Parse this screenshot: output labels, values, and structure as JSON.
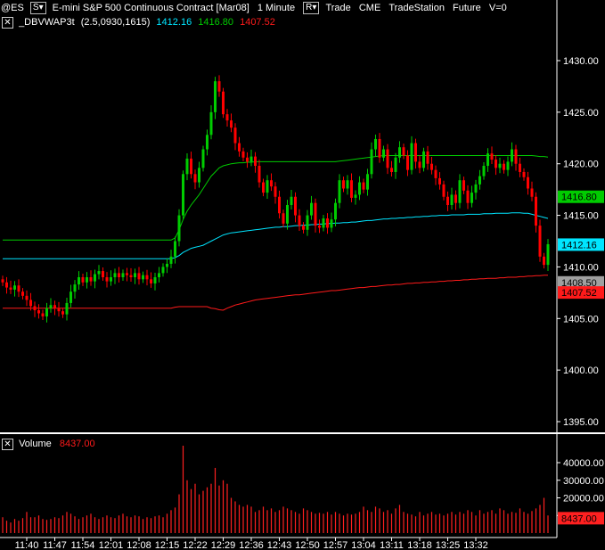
{
  "header": {
    "symbol": "@ES",
    "symbol_button": "S▾",
    "description": "E-mini S&P 500 Continuous Contract [Mar08]",
    "interval": "1 Minute",
    "range_button": "R▾",
    "mode": "Trade",
    "exchange": "CME",
    "source": "TradeStation",
    "category": "Future",
    "volume_flag": "V=0"
  },
  "indicator": {
    "close_icon": "close-x-icon",
    "name": "_DBVWAP3t",
    "params": "(2.5,0930,1615)",
    "value_cyan": "1412.16",
    "value_green": "1416.80",
    "value_red": "1407.52"
  },
  "volume_panel": {
    "close_icon": "close-x-icon",
    "title": "Volume",
    "value": "8437.00"
  },
  "colors": {
    "up": "#00cc00",
    "down": "#ff0000",
    "vwap": "#00e5ff",
    "upper_band": "#00cc00",
    "lower_band": "#ff1a1a",
    "volume": "#ff2020",
    "axis_text": "#ffffff",
    "separator": "#ffffff"
  },
  "chart_data": [
    {
      "type": "candlestick",
      "ylim": [
        1393.5,
        1432
      ],
      "price_ticks": [
        1430.0,
        1425.0,
        1420.0,
        1415.0,
        1410.0,
        1405.0,
        1400.0,
        1395.0
      ],
      "price_tick_labels": [
        "1430.00",
        "1425.00",
        "1420.00",
        "1415.00",
        "1410.00",
        "1405.00",
        "1400.00",
        "1395.00"
      ],
      "time_labels": [
        "11:40",
        "11:47",
        "11:54",
        "12:01",
        "12:08",
        "12:15",
        "12:22",
        "12:29",
        "12:36",
        "12:43",
        "12:50",
        "12:57",
        "13:04",
        "13:11",
        "13:18",
        "13:25",
        "13:32"
      ],
      "bar_minutes_start": "11:34",
      "close": [
        1408.5,
        1408.0,
        1407.8,
        1408.2,
        1407.6,
        1407.2,
        1406.8,
        1406.2,
        1405.8,
        1405.5,
        1405.2,
        1406.0,
        1406.3,
        1406.0,
        1405.7,
        1405.4,
        1406.5,
        1407.6,
        1408.3,
        1409.0,
        1408.5,
        1409.0,
        1408.6,
        1409.3,
        1409.6,
        1409.0,
        1408.6,
        1409.0,
        1409.4,
        1409.0,
        1409.4,
        1409.2,
        1409.0,
        1409.4,
        1408.8,
        1409.2,
        1408.8,
        1408.4,
        1409.0,
        1409.4,
        1410.0,
        1410.3,
        1411.0,
        1412.5,
        1415.0,
        1419.0,
        1420.5,
        1419.0,
        1418.2,
        1419.6,
        1421.4,
        1422.8,
        1425.0,
        1428.0,
        1427.0,
        1424.8,
        1424.2,
        1423.5,
        1422.0,
        1421.2,
        1420.6,
        1420.2,
        1420.7,
        1419.8,
        1418.2,
        1417.2,
        1418.4,
        1417.8,
        1416.8,
        1415.2,
        1414.2,
        1416.0,
        1416.8,
        1415.0,
        1414.0,
        1413.6,
        1415.0,
        1416.2,
        1414.0,
        1413.8,
        1414.7,
        1413.8,
        1414.6,
        1416.2,
        1418.4,
        1417.6,
        1418.4,
        1416.7,
        1417.0,
        1418.2,
        1417.5,
        1419.0,
        1421.4,
        1422.4,
        1420.6,
        1421.4,
        1419.6,
        1419.2,
        1420.6,
        1421.6,
        1420.8,
        1419.4,
        1422.0,
        1420.2,
        1419.6,
        1421.2,
        1420.0,
        1419.4,
        1418.6,
        1418.0,
        1416.8,
        1416.0,
        1417.0,
        1416.2,
        1418.4,
        1417.4,
        1416.2,
        1417.2,
        1418.0,
        1418.8,
        1419.8,
        1421.0,
        1420.4,
        1419.6,
        1420.0,
        1419.4,
        1420.2,
        1421.4,
        1420.0,
        1419.2,
        1418.7,
        1417.6,
        1416.8,
        1414.0,
        1411.0,
        1410.2,
        1412.2
      ],
      "vwap_curve": [
        1410.8,
        1410.8,
        1410.8,
        1410.8,
        1410.8,
        1410.8,
        1410.8,
        1410.8,
        1410.8,
        1410.8,
        1410.8,
        1410.8,
        1410.8,
        1410.8,
        1410.8,
        1410.8,
        1410.8,
        1410.8,
        1410.8,
        1410.8,
        1410.8,
        1410.8,
        1410.8,
        1410.8,
        1410.8,
        1410.8,
        1410.8,
        1410.8,
        1410.8,
        1410.8,
        1410.8,
        1410.8,
        1410.8,
        1410.8,
        1410.8,
        1410.8,
        1410.8,
        1410.8,
        1410.8,
        1410.8,
        1410.8,
        1410.8,
        1410.8,
        1410.9,
        1411.1,
        1411.4,
        1411.6,
        1411.8,
        1411.9,
        1412.0,
        1412.1,
        1412.3,
        1412.5,
        1412.7,
        1412.9,
        1413.1,
        1413.2,
        1413.3,
        1413.35,
        1413.4,
        1413.45,
        1413.5,
        1413.55,
        1413.6,
        1413.65,
        1413.7,
        1413.75,
        1413.8,
        1413.85,
        1413.85,
        1413.9,
        1413.9,
        1413.95,
        1414.0,
        1414.0,
        1414.05,
        1414.05,
        1414.1,
        1414.1,
        1414.15,
        1414.15,
        1414.2,
        1414.2,
        1414.25,
        1414.25,
        1414.3,
        1414.3,
        1414.35,
        1414.35,
        1414.4,
        1414.45,
        1414.5,
        1414.5,
        1414.55,
        1414.6,
        1414.65,
        1414.65,
        1414.7,
        1414.7,
        1414.75,
        1414.75,
        1414.8,
        1414.8,
        1414.85,
        1414.85,
        1414.9,
        1414.9,
        1414.95,
        1414.95,
        1415.0,
        1415.0,
        1415.0,
        1415.05,
        1415.05,
        1415.05,
        1415.05,
        1415.1,
        1415.1,
        1415.1,
        1415.1,
        1415.15,
        1415.15,
        1415.15,
        1415.2,
        1415.2,
        1415.2,
        1415.2,
        1415.25,
        1415.25,
        1415.25,
        1415.2,
        1415.2,
        1415.1,
        1415.0,
        1414.9,
        1414.8,
        1414.7
      ],
      "upper_band_curve": [
        1412.6,
        1412.6,
        1412.6,
        1412.6,
        1412.6,
        1412.6,
        1412.6,
        1412.6,
        1412.6,
        1412.6,
        1412.6,
        1412.6,
        1412.6,
        1412.6,
        1412.6,
        1412.6,
        1412.6,
        1412.6,
        1412.6,
        1412.6,
        1412.6,
        1412.6,
        1412.6,
        1412.6,
        1412.6,
        1412.6,
        1412.6,
        1412.6,
        1412.6,
        1412.6,
        1412.6,
        1412.6,
        1412.6,
        1412.6,
        1412.6,
        1412.6,
        1412.6,
        1412.6,
        1412.6,
        1412.6,
        1412.6,
        1412.6,
        1412.6,
        1412.8,
        1413.6,
        1414.6,
        1415.4,
        1416.0,
        1416.5,
        1417.0,
        1417.6,
        1418.2,
        1418.8,
        1419.2,
        1419.6,
        1419.8,
        1419.9,
        1420.0,
        1420.05,
        1420.1,
        1420.1,
        1420.15,
        1420.15,
        1420.2,
        1420.2,
        1420.2,
        1420.2,
        1420.2,
        1420.2,
        1420.2,
        1420.2,
        1420.2,
        1420.2,
        1420.2,
        1420.2,
        1420.2,
        1420.2,
        1420.2,
        1420.2,
        1420.2,
        1420.2,
        1420.2,
        1420.2,
        1420.2,
        1420.25,
        1420.3,
        1420.35,
        1420.4,
        1420.45,
        1420.5,
        1420.55,
        1420.6,
        1420.65,
        1420.7,
        1420.75,
        1420.8,
        1420.8,
        1420.8,
        1420.8,
        1420.8,
        1420.8,
        1420.8,
        1420.8,
        1420.8,
        1420.8,
        1420.8,
        1420.8,
        1420.8,
        1420.8,
        1420.8,
        1420.8,
        1420.8,
        1420.8,
        1420.8,
        1420.8,
        1420.8,
        1420.8,
        1420.8,
        1420.8,
        1420.8,
        1420.8,
        1420.8,
        1420.8,
        1420.8,
        1420.8,
        1420.8,
        1420.8,
        1420.8,
        1420.8,
        1420.8,
        1420.8,
        1420.8,
        1420.8,
        1420.75,
        1420.7,
        1420.7,
        1420.65
      ],
      "lower_band_curve": [
        1406.0,
        1406.0,
        1406.0,
        1406.0,
        1406.0,
        1406.0,
        1406.0,
        1406.0,
        1406.0,
        1406.0,
        1406.0,
        1406.0,
        1406.0,
        1406.0,
        1406.0,
        1406.0,
        1406.0,
        1406.0,
        1406.0,
        1406.0,
        1406.0,
        1406.0,
        1406.0,
        1406.0,
        1406.0,
        1406.0,
        1406.0,
        1406.0,
        1406.0,
        1406.0,
        1406.0,
        1406.0,
        1406.0,
        1406.0,
        1406.0,
        1406.0,
        1406.0,
        1406.0,
        1406.0,
        1406.0,
        1406.0,
        1406.0,
        1406.0,
        1406.1,
        1406.15,
        1406.15,
        1406.15,
        1406.15,
        1406.15,
        1406.15,
        1406.15,
        1406.15,
        1406.0,
        1405.95,
        1405.85,
        1405.8,
        1406.0,
        1406.15,
        1406.3,
        1406.4,
        1406.5,
        1406.6,
        1406.7,
        1406.8,
        1406.85,
        1406.9,
        1406.95,
        1407.0,
        1407.05,
        1407.1,
        1407.15,
        1407.2,
        1407.25,
        1407.3,
        1407.3,
        1407.35,
        1407.4,
        1407.45,
        1407.5,
        1407.55,
        1407.6,
        1407.65,
        1407.7,
        1407.7,
        1407.75,
        1407.8,
        1407.85,
        1407.9,
        1407.95,
        1408.0,
        1408.0,
        1408.05,
        1408.1,
        1408.1,
        1408.15,
        1408.2,
        1408.25,
        1408.25,
        1408.3,
        1408.3,
        1408.35,
        1408.4,
        1408.4,
        1408.45,
        1408.45,
        1408.5,
        1408.5,
        1408.55,
        1408.55,
        1408.6,
        1408.6,
        1408.65,
        1408.65,
        1408.7,
        1408.7,
        1408.75,
        1408.75,
        1408.8,
        1408.8,
        1408.85,
        1408.85,
        1408.9,
        1408.9,
        1408.9,
        1408.95,
        1408.95,
        1409.0,
        1409.0,
        1409.0,
        1409.05,
        1409.05,
        1409.1,
        1409.1,
        1409.15,
        1409.15,
        1409.2,
        1409.2
      ],
      "price_markers": [
        {
          "label": "1416.80",
          "value": 1416.8,
          "bg": "#00cc00",
          "fg": "#000000"
        },
        {
          "label": "1412.16",
          "value": 1412.16,
          "bg": "#00e5ff",
          "fg": "#000000"
        },
        {
          "label": "1408.50",
          "value": 1408.5,
          "bg": "#a0a0a0",
          "fg": "#000000"
        },
        {
          "label": "1407.52",
          "value": 1407.52,
          "bg": "#ff1a1a",
          "fg": "#000000"
        }
      ]
    },
    {
      "type": "bar",
      "ylim": [
        0,
        45000
      ],
      "ticks": [
        40000,
        30000,
        20000,
        10000
      ],
      "tick_labels": [
        "40000.00",
        "30000.00",
        "20000.00",
        "10000.00"
      ],
      "last_value_label": "8437.00",
      "values": [
        9000,
        7000,
        6000,
        8000,
        7000,
        8500,
        12000,
        9000,
        9000,
        10000,
        8000,
        7500,
        8000,
        9000,
        8500,
        10000,
        12000,
        11000,
        9500,
        8000,
        9000,
        10000,
        11000,
        9000,
        8000,
        9000,
        10000,
        9000,
        8500,
        10000,
        11000,
        9500,
        9000,
        10000,
        9500,
        8000,
        9000,
        8500,
        9500,
        10000,
        9000,
        11000,
        13000,
        14500,
        22000,
        50000,
        30000,
        25000,
        28000,
        22000,
        24000,
        26000,
        28000,
        37000,
        27000,
        30000,
        28000,
        20000,
        18000,
        16000,
        15000,
        16000,
        15000,
        12000,
        13000,
        15000,
        13000,
        14000,
        12000,
        13000,
        15000,
        14000,
        13000,
        12000,
        11000,
        14000,
        13000,
        12000,
        11000,
        11500,
        11000,
        12000,
        10500,
        12000,
        11000,
        10000,
        11000,
        10500,
        11000,
        12000,
        15000,
        13000,
        12000,
        15000,
        14000,
        12000,
        13000,
        11000,
        14000,
        16000,
        12000,
        11000,
        10500,
        9500,
        12000,
        10000,
        11000,
        12000,
        10500,
        11000,
        10000,
        11000,
        12000,
        10500,
        12000,
        11000,
        13000,
        12000,
        10000,
        13000,
        11000,
        12000,
        13000,
        11000,
        14000,
        13000,
        11000,
        12000,
        11500,
        14000,
        12000,
        11000,
        12500,
        14000,
        16000,
        20000,
        10000
      ]
    }
  ]
}
